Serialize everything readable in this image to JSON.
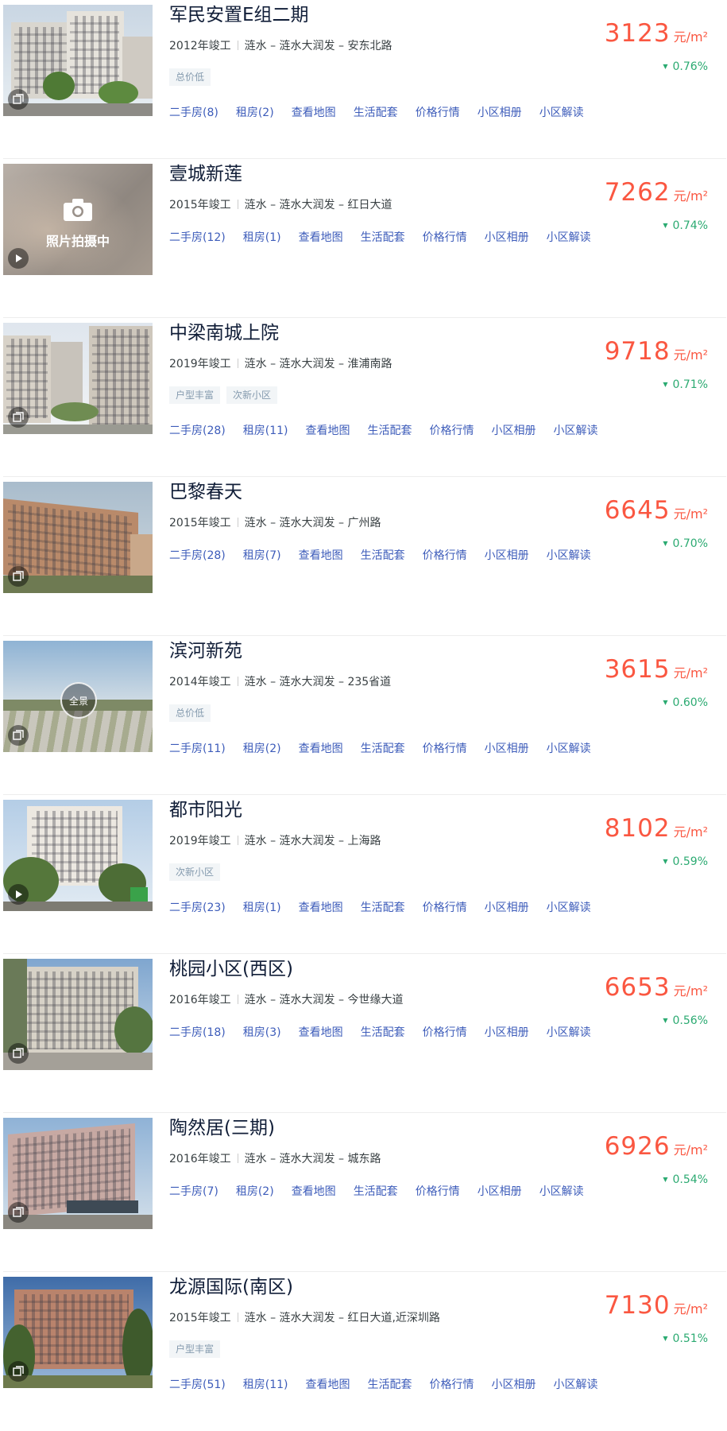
{
  "unit": "元/m²",
  "colors": {
    "price": "#fa5741",
    "change_down": "#2baa71",
    "link": "#3d5cba",
    "title": "#101d37"
  },
  "items": [
    {
      "title": "军民安置E组二期",
      "meta": [
        "2012年竣工",
        "涟水 – 涟水大润发 – 安东北路"
      ],
      "tags": [
        "总价低"
      ],
      "links": [
        "二手房(8)",
        "租房(2)",
        "查看地图",
        "生活配套",
        "价格行情",
        "小区相册",
        "小区解读"
      ],
      "price": "3123",
      "change": "0.76%",
      "thumb_icon": "album-icon",
      "thumb_caption": ""
    },
    {
      "title": "壹城新莲",
      "meta": [
        "2015年竣工",
        "涟水 – 涟水大润发 – 红日大道"
      ],
      "tags": [],
      "links": [
        "二手房(12)",
        "租房(1)",
        "查看地图",
        "生活配套",
        "价格行情",
        "小区相册",
        "小区解读"
      ],
      "price": "7262",
      "change": "0.74%",
      "thumb_icon": "play-icon",
      "thumb_caption": "照片拍摄中"
    },
    {
      "title": "中梁南城上院",
      "meta": [
        "2019年竣工",
        "涟水 – 涟水大润发 – 淮浦南路"
      ],
      "tags": [
        "户型丰富",
        "次新小区"
      ],
      "links": [
        "二手房(28)",
        "租房(11)",
        "查看地图",
        "生活配套",
        "价格行情",
        "小区相册",
        "小区解读"
      ],
      "price": "9718",
      "change": "0.71%",
      "thumb_icon": "album-icon",
      "thumb_caption": ""
    },
    {
      "title": "巴黎春天",
      "meta": [
        "2015年竣工",
        "涟水 – 涟水大润发 – 广州路"
      ],
      "tags": [],
      "links": [
        "二手房(28)",
        "租房(7)",
        "查看地图",
        "生活配套",
        "价格行情",
        "小区相册",
        "小区解读"
      ],
      "price": "6645",
      "change": "0.70%",
      "thumb_icon": "album-icon",
      "thumb_caption": ""
    },
    {
      "title": "滨河新苑",
      "meta": [
        "2014年竣工",
        "涟水 – 涟水大润发 – 235省道"
      ],
      "tags": [
        "总价低"
      ],
      "links": [
        "二手房(11)",
        "租房(2)",
        "查看地图",
        "生活配套",
        "价格行情",
        "小区相册",
        "小区解读"
      ],
      "price": "3615",
      "change": "0.60%",
      "thumb_icon": "album-icon",
      "thumb_caption": "全景"
    },
    {
      "title": "都市阳光",
      "meta": [
        "2019年竣工",
        "涟水 – 涟水大润发 – 上海路"
      ],
      "tags": [
        "次新小区"
      ],
      "links": [
        "二手房(23)",
        "租房(1)",
        "查看地图",
        "生活配套",
        "价格行情",
        "小区相册",
        "小区解读"
      ],
      "price": "8102",
      "change": "0.59%",
      "thumb_icon": "play-icon",
      "thumb_caption": ""
    },
    {
      "title": "桃园小区(西区)",
      "meta": [
        "2016年竣工",
        "涟水 – 涟水大润发 – 今世缘大道"
      ],
      "tags": [],
      "links": [
        "二手房(18)",
        "租房(3)",
        "查看地图",
        "生活配套",
        "价格行情",
        "小区相册",
        "小区解读"
      ],
      "price": "6653",
      "change": "0.56%",
      "thumb_icon": "album-icon",
      "thumb_caption": ""
    },
    {
      "title": "陶然居(三期)",
      "meta": [
        "2016年竣工",
        "涟水 – 涟水大润发 – 城东路"
      ],
      "tags": [],
      "links": [
        "二手房(7)",
        "租房(2)",
        "查看地图",
        "生活配套",
        "价格行情",
        "小区相册",
        "小区解读"
      ],
      "price": "6926",
      "change": "0.54%",
      "thumb_icon": "album-icon",
      "thumb_caption": ""
    },
    {
      "title": "龙源国际(南区)",
      "meta": [
        "2015年竣工",
        "涟水 – 涟水大润发 – 红日大道,近深圳路"
      ],
      "tags": [
        "户型丰富"
      ],
      "links": [
        "二手房(51)",
        "租房(11)",
        "查看地图",
        "生活配套",
        "价格行情",
        "小区相册",
        "小区解读"
      ],
      "price": "7130",
      "change": "0.51%",
      "thumb_icon": "album-icon",
      "thumb_caption": ""
    }
  ]
}
